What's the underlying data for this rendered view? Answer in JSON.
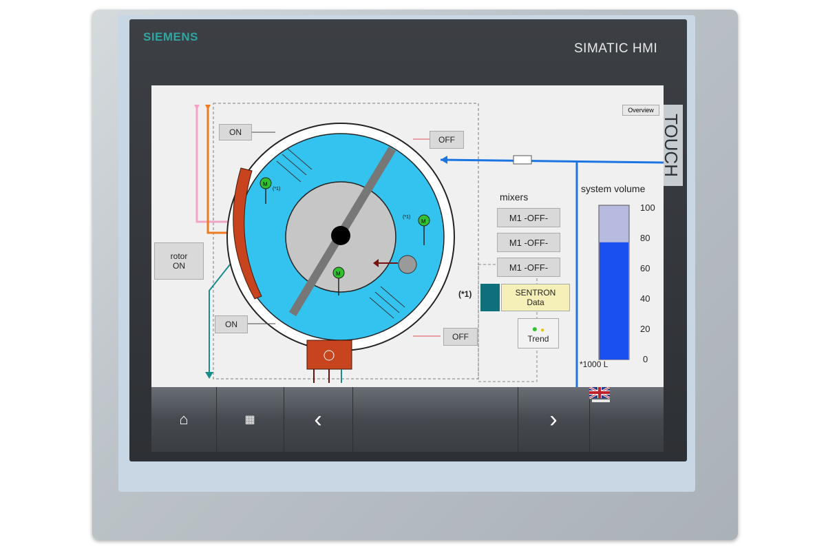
{
  "device": {
    "brand": "SIEMENS",
    "product": "SIMATIC HMI",
    "touch_label": "TOUCH"
  },
  "screen": {
    "overview_label": "Overview",
    "buttons": {
      "on_top": "ON",
      "off_top": "OFF",
      "rotor": "rotor\nON",
      "on_bottom": "ON",
      "off_bottom": "OFF"
    },
    "mixers": {
      "title": "mixers",
      "items": [
        "M1 -OFF-",
        "M1 -OFF-",
        "M1 -OFF-"
      ]
    },
    "footnote_marker": "(*1)",
    "sentron": {
      "line1": "SENTRON",
      "line2": "Data"
    },
    "trend_label": "Trend",
    "motor_label": "M",
    "motor_footnote": "(*1)",
    "system_volume": {
      "title": "system volume",
      "ticks": [
        "100",
        "80",
        "60",
        "40",
        "20",
        "0"
      ],
      "unit": "*1000 L",
      "level_percent": 76,
      "max_level_percent": 100
    },
    "colors": {
      "tank_cyan": "#33c3ee",
      "bar_fill": "#1a4ff0",
      "bar_empty": "#b7bbdf",
      "pipe_blue": "#1c74e0",
      "heater_red": "#c8441e"
    }
  },
  "navigation": {
    "items": [
      {
        "name": "home",
        "icon": "home-icon",
        "glyph": "⌂"
      },
      {
        "name": "menu",
        "icon": "grid-icon",
        "glyph": "▦"
      },
      {
        "name": "back",
        "icon": "chevron-left-icon",
        "glyph": "‹"
      },
      {
        "name": "forward",
        "icon": "chevron-right-icon",
        "glyph": "›"
      },
      {
        "name": "language",
        "icon": "uk-flag-icon",
        "glyph": ""
      }
    ]
  }
}
